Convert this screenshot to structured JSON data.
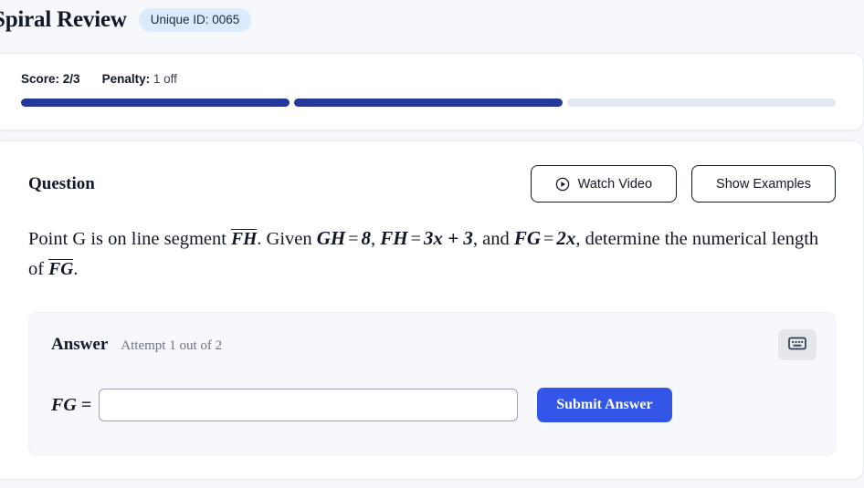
{
  "header": {
    "title": "Spiral Review",
    "badge": "Unique ID: 0065"
  },
  "score_card": {
    "score_label": "Score:",
    "score_value": "2/3",
    "penalty_label": "Penalty:",
    "penalty_value": "1 off",
    "progress": {
      "total": 3,
      "filled": 2,
      "segments": [
        "filled",
        "filled",
        "empty"
      ],
      "filled_color": "#25379b",
      "empty_color": "#e2e8f0"
    }
  },
  "question_card": {
    "title": "Question",
    "watch_video_label": "Watch Video",
    "watch_video_icon": "play-circle-icon",
    "show_examples_label": "Show Examples",
    "text": {
      "part1": "Point G is on line segment ",
      "seg1": "FH",
      "part2": ". Given ",
      "expr1": "GH",
      "eq1": "=",
      "val1": "8",
      "part3": ", ",
      "expr2": "FH",
      "eq2": "=",
      "val2": "3x + 3",
      "part4": ", and ",
      "expr3": "FG",
      "eq3": "=",
      "val3": "2x",
      "part5": ", determine the numerical length of ",
      "seg2": "FG",
      "part6": "."
    }
  },
  "answer_panel": {
    "title": "Answer",
    "attempt_text": "Attempt 1 out of 2",
    "keyboard_icon": "keyboard-icon",
    "answer_label": "FG =",
    "input_value": "",
    "input_placeholder": "",
    "submit_label": "Submit Answer",
    "submit_color": "#3355e8"
  }
}
